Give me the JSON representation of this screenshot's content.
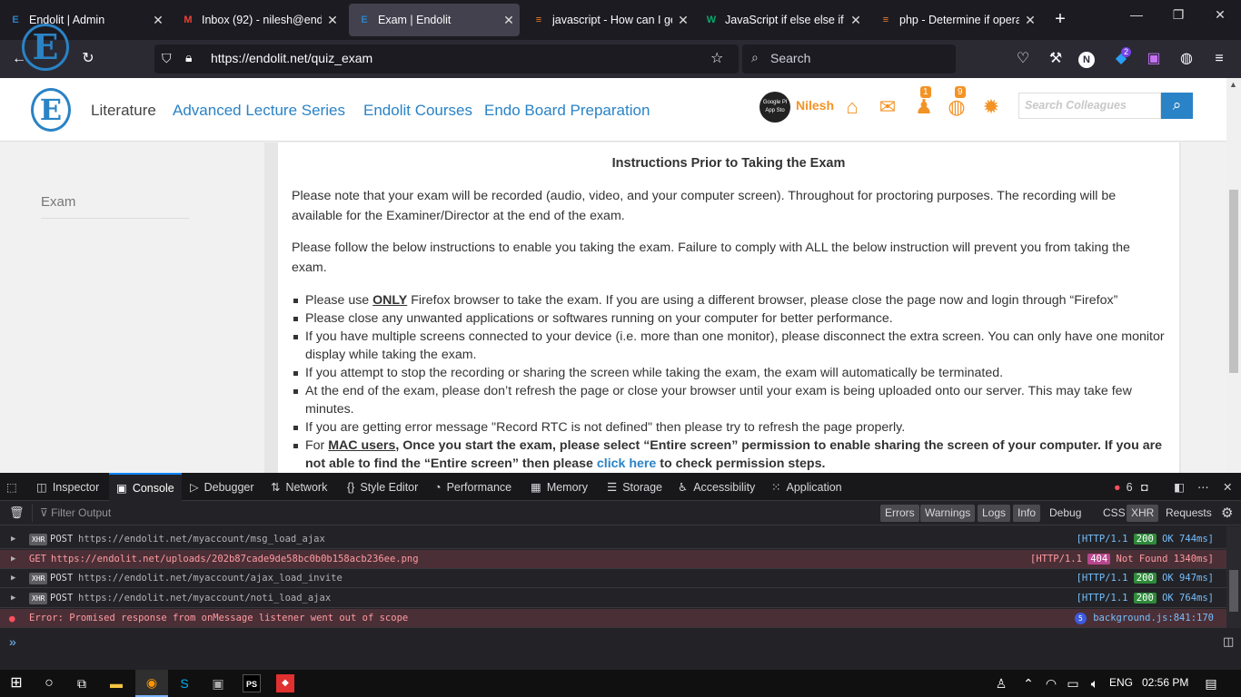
{
  "tabs": [
    {
      "title": "Endolit | Admin",
      "favicon": "endolit-logo-icon"
    },
    {
      "title": "Inbox (92) - nilesh@endol",
      "favicon": "gmail-icon"
    },
    {
      "title": "Exam | Endolit",
      "favicon": "endolit-logo-icon",
      "active": true
    },
    {
      "title": "javascript - How can I get",
      "favicon": "stackoverflow-icon"
    },
    {
      "title": "JavaScript if else else if",
      "favicon": "w3schools-icon"
    },
    {
      "title": "php - Determine if operat",
      "favicon": "stackoverflow-icon"
    }
  ],
  "url": "https://endolit.net/quiz_exam",
  "search_placeholder": "Search",
  "notification_count": "2",
  "site": {
    "menu": [
      "Literature",
      "Advanced Lecture Series",
      "Endolit Courses",
      "Endo Board Preparation"
    ],
    "user_name": "Nilesh",
    "app_badge_line1": "Google Pl",
    "app_badge_line2": "App Sto",
    "badge_requests": "1",
    "badge_globe": "9",
    "search_placeholder": "Search Colleagues",
    "sidebar_item": "Exam"
  },
  "content": {
    "heading": "Instructions Prior to Taking the Exam",
    "para1": "Please note that your exam will be recorded (audio, video, and your computer screen). Throughout for proctoring purposes. The recording will be available for the Examiner/Director at the end of the exam.",
    "para2": "Please follow the below instructions to enable you taking the exam. Failure to comply with ALL the below instruction will prevent you from taking the exam.",
    "b1_pre": "Please use ",
    "b1_strong": "ONLY",
    "b1_post": " Firefox browser to take the exam. If you are using a different browser, please close the page now and login through “Firefox”",
    "b2": "Please close any unwanted applications or softwares running on your computer for better performance.",
    "b3": "If you have multiple screens connected to your device (i.e. more than one monitor), please disconnect the extra screen. You can only have one monitor display while taking the exam.",
    "b4": "If you attempt to stop the recording or sharing the screen while taking the exam, the exam will automatically be terminated.",
    "b5": "At the end of the exam, please don’t refresh the page or close your browser until your exam is being uploaded onto our server. This may take few minutes.",
    "b6": "If you are getting error message \"Record RTC is not defined\" then please try to refresh the page properly.",
    "b7_pre": "For ",
    "b7_mac": "MAC users",
    "b7_mid": ", Once you start the exam, please select “Entire screen” permission to enable sharing the screen of your computer. If you are not able to find the “Entire screen” then please ",
    "b7_link": "click here",
    "b7_post": " to check permission steps."
  },
  "devtools": {
    "tabs": [
      "Inspector",
      "Console",
      "Debugger",
      "Network",
      "Style Editor",
      "Performance",
      "Memory",
      "Storage",
      "Accessibility",
      "Application"
    ],
    "error_count": "6",
    "filter_placeholder": "Filter Output",
    "filters": [
      "Errors",
      "Warnings",
      "Logs",
      "Info",
      "Debug",
      "CSS",
      "XHR",
      "Requests"
    ],
    "rows": [
      {
        "type": "xhr",
        "method": "POST",
        "url": "https://endolit.net/myaccount/msg_load_ajax",
        "proto": "[HTTP/1.1",
        "status": "200",
        "tail": "OK 744ms]"
      },
      {
        "type": "err404",
        "method": "GET",
        "url": "https://endolit.net/uploads/202b87cade9de58bc0b0b158acb236ee.png",
        "proto": "[HTTP/1.1",
        "status": "404",
        "tail": "Not Found 1340ms]"
      },
      {
        "type": "xhr",
        "method": "POST",
        "url": "https://endolit.net/myaccount/ajax_load_invite",
        "proto": "[HTTP/1.1",
        "status": "200",
        "tail": "OK 947ms]"
      },
      {
        "type": "xhr",
        "method": "POST",
        "url": "https://endolit.net/myaccount/noti_load_ajax",
        "proto": "[HTTP/1.1",
        "status": "200",
        "tail": "OK 764ms]"
      }
    ],
    "error_message": "Error: Promised response from onMessage listener went out of scope",
    "error_repeat": "5",
    "error_source": "background.js:841:170",
    "xhr_label": "XHR"
  },
  "taskbar": {
    "lang": "ENG",
    "time": "02:56 PM"
  },
  "colors": {
    "accent": "#2a83c6",
    "brand_orange": "#f39325",
    "devtools_bg": "#232327"
  }
}
